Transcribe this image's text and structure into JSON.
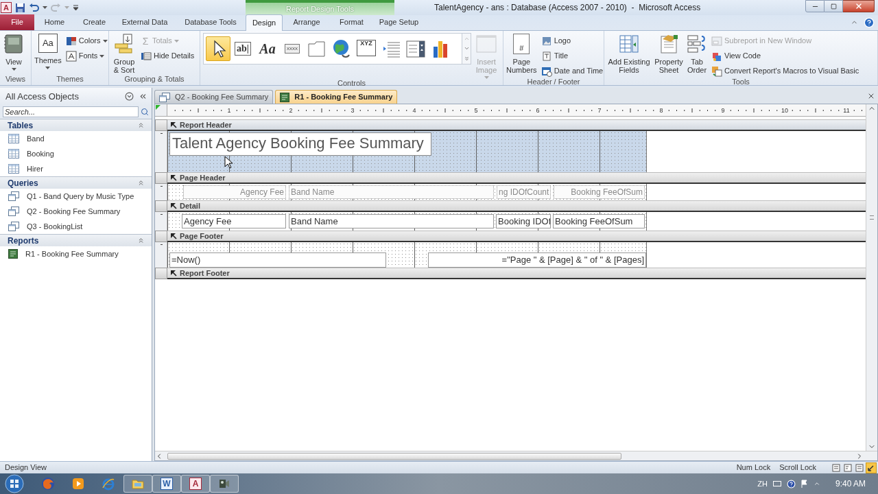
{
  "title_bar": {
    "app_glyph": "A",
    "context_label": "Report Design Tools",
    "title": "TalentAgency - ans : Database (Access 2007 - 2010)  -  Microsoft Access"
  },
  "ribbon_tabs": [
    {
      "label": "File",
      "kind": "file",
      "selected": false
    },
    {
      "label": "Home",
      "kind": "tab",
      "selected": false
    },
    {
      "label": "Create",
      "kind": "tab",
      "selected": false
    },
    {
      "label": "External Data",
      "kind": "tab",
      "selected": false
    },
    {
      "label": "Database Tools",
      "kind": "tab",
      "selected": false
    },
    {
      "label": "Design",
      "kind": "tab",
      "selected": true
    },
    {
      "label": "Arrange",
      "kind": "tab",
      "selected": false
    },
    {
      "label": "Format",
      "kind": "tab",
      "selected": false
    },
    {
      "label": "Page Setup",
      "kind": "tab",
      "selected": false
    }
  ],
  "ribbon_groups": [
    {
      "label": "Views",
      "commands": [
        {
          "label": "View",
          "kind": "large",
          "dropdown": true,
          "disabled": false
        }
      ]
    },
    {
      "label": "Themes",
      "commands": [
        {
          "label": "Themes",
          "kind": "large",
          "glyph": "Aa",
          "dropdown": true,
          "disabled": false
        },
        {
          "label": "Colors",
          "kind": "small",
          "dropdown": true,
          "disabled": false
        },
        {
          "label": "Fonts",
          "kind": "small",
          "dropdown": true,
          "disabled": false
        }
      ]
    },
    {
      "label": "Grouping & Totals",
      "commands": [
        {
          "label": "Group & Sort",
          "kind": "large",
          "dropdown": false,
          "disabled": false
        },
        {
          "label": "Totals",
          "kind": "small",
          "glyph": "Σ",
          "dropdown": true,
          "disabled": true
        },
        {
          "label": "Hide Details",
          "kind": "small",
          "dropdown": false,
          "disabled": false
        }
      ]
    },
    {
      "label": "Controls",
      "commands": [
        {
          "kind": "gallery",
          "items": [
            {
              "kind": "pointer",
              "selected": true
            },
            {
              "kind": "textbox",
              "glyph": "ab|",
              "selected": false
            },
            {
              "kind": "label",
              "glyph": "Aa",
              "selected": false
            },
            {
              "kind": "button",
              "glyph": "xxxx",
              "selected": false
            },
            {
              "kind": "tab",
              "selected": false
            },
            {
              "kind": "hyperlink",
              "selected": false
            },
            {
              "kind": "option-group",
              "glyph": "XYZ",
              "selected": false
            },
            {
              "kind": "page-break",
              "selected": false
            },
            {
              "kind": "combo",
              "selected": false
            },
            {
              "kind": "chart",
              "selected": false
            }
          ]
        },
        {
          "label": "Insert Image",
          "kind": "large",
          "dropdown": true,
          "disabled": true
        }
      ]
    },
    {
      "label": "Header / Footer",
      "commands": [
        {
          "label": "Page Numbers",
          "kind": "large",
          "glyph": "#",
          "dropdown": false,
          "disabled": false
        },
        {
          "label": "Logo",
          "kind": "small",
          "dropdown": false,
          "disabled": false
        },
        {
          "label": "Title",
          "kind": "small",
          "dropdown": false,
          "disabled": false
        },
        {
          "label": "Date and Time",
          "kind": "small",
          "dropdown": false,
          "disabled": false
        }
      ]
    },
    {
      "label": "Tools",
      "commands": [
        {
          "label": "Add Existing Fields",
          "kind": "large",
          "dropdown": false,
          "disabled": false
        },
        {
          "label": "Property Sheet",
          "kind": "large",
          "dropdown": false,
          "disabled": false
        },
        {
          "label": "Tab Order",
          "kind": "large",
          "dropdown": false,
          "disabled": false
        },
        {
          "label": "Subreport in New Window",
          "kind": "small",
          "dropdown": false,
          "disabled": true
        },
        {
          "label": "View Code",
          "kind": "small",
          "dropdown": false,
          "disabled": false
        },
        {
          "label": "Convert Report's Macros to Visual Basic",
          "kind": "small",
          "dropdown": false,
          "disabled": false
        }
      ]
    }
  ],
  "nav_pane": {
    "title": "All Access Objects",
    "search": {
      "placeholder": "Search..."
    },
    "groups": [
      {
        "label": "Tables",
        "kind": "table",
        "expanded": true,
        "items": [
          {
            "label": "Band",
            "selected": false
          },
          {
            "label": "Booking",
            "selected": false
          },
          {
            "label": "Hirer",
            "selected": false
          }
        ]
      },
      {
        "label": "Queries",
        "kind": "query",
        "expanded": true,
        "items": [
          {
            "label": "Q1 - Band Query by Music Type",
            "selected": false
          },
          {
            "label": "Q2 - Booking Fee Summary",
            "selected": false
          },
          {
            "label": "Q3 - BookingList",
            "selected": false
          }
        ]
      },
      {
        "label": "Reports",
        "kind": "report",
        "expanded": true,
        "items": [
          {
            "label": "R1 - Booking Fee Summary",
            "selected": false
          }
        ]
      }
    ]
  },
  "documents": [
    {
      "label": "Q2 - Booking Fee Summary",
      "kind": "query",
      "selected": false
    },
    {
      "label": "R1 - Booking Fee Summary",
      "kind": "report",
      "selected": true
    }
  ],
  "ruler": {
    "numbers": [
      "1",
      "2",
      "3",
      "4",
      "5",
      "6",
      "7",
      "8",
      "9",
      "10",
      "11"
    ]
  },
  "sections": [
    {
      "label": "Report Header",
      "selected": true,
      "controls": [
        {
          "text": "Talent Agency Booking Fee Summary",
          "kind": "title"
        }
      ]
    },
    {
      "label": "Page Header",
      "selected": false,
      "controls": [
        {
          "text": "Agency Fee",
          "kind": "label"
        },
        {
          "text": "Band Name",
          "kind": "label"
        },
        {
          "text": "ng IDOfCount",
          "kind": "label"
        },
        {
          "text": "Booking FeeOfSum",
          "kind": "label"
        }
      ]
    },
    {
      "label": "Detail",
      "selected": false,
      "controls": [
        {
          "text": "Agency Fee",
          "kind": "textbox"
        },
        {
          "text": "Band Name",
          "kind": "textbox"
        },
        {
          "text": "Booking IDOf",
          "kind": "textbox"
        },
        {
          "text": "Booking FeeOfSum",
          "kind": "textbox"
        }
      ]
    },
    {
      "label": "Page Footer",
      "selected": false,
      "controls": [
        {
          "text": "=Now()",
          "kind": "textbox"
        },
        {
          "text": "=\"Page \" & [Page] & \" of \" & [Pages]",
          "kind": "textbox"
        }
      ]
    },
    {
      "label": "Report Footer",
      "selected": false
    }
  ],
  "status_bar": {
    "view": "Design View",
    "indicators": [
      "Num Lock",
      "Scroll Lock"
    ],
    "views": [
      {
        "kind": "report",
        "selected": false
      },
      {
        "kind": "print-preview",
        "selected": false
      },
      {
        "kind": "layout",
        "selected": false
      },
      {
        "kind": "design",
        "selected": true
      }
    ]
  },
  "taskbar": {
    "apps": [
      {
        "kind": "firefox",
        "open": false
      },
      {
        "kind": "media",
        "open": false
      },
      {
        "kind": "ie",
        "open": false
      },
      {
        "kind": "explorer",
        "open": true
      },
      {
        "kind": "word",
        "glyph": "W",
        "open": true
      },
      {
        "kind": "access",
        "glyph": "A",
        "open": true
      },
      {
        "kind": "app",
        "open": true
      }
    ],
    "language": "ZH",
    "time": "9:40 AM"
  }
}
